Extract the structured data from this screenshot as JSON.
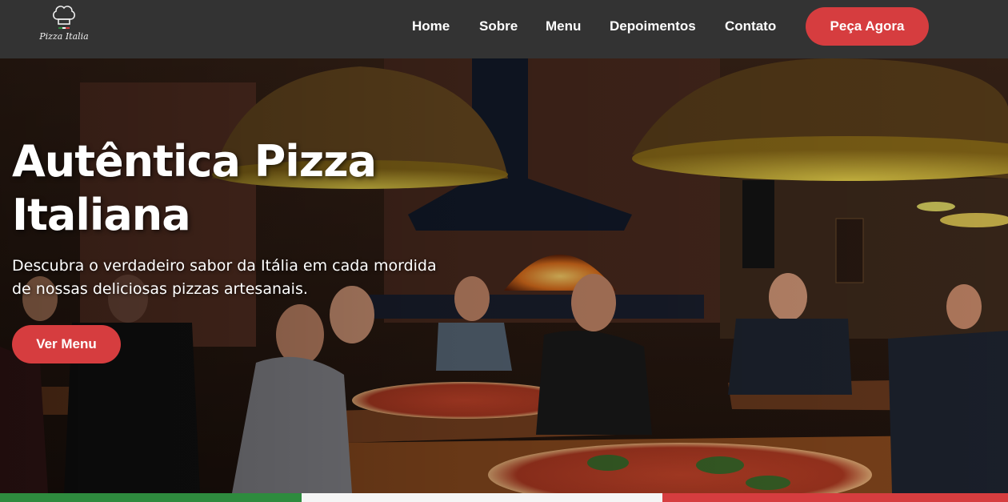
{
  "brand": {
    "name": "Pizza Italia",
    "logo_icon": "chef-hat-icon"
  },
  "nav": {
    "links": [
      "Home",
      "Sobre",
      "Menu",
      "Depoimentos",
      "Contato"
    ],
    "cta_label": "Peça Agora"
  },
  "hero": {
    "title": "Autêntica Pizza Italiana",
    "subtitle": "Descubra o verdadeiro sabor da Itália em cada mordida de nossas deliciosas pizzas artesanais.",
    "button_label": "Ver Menu"
  },
  "colors": {
    "navbar": "#333333",
    "accent": "#d63d3f",
    "flag_green": "#2e8b3e",
    "flag_white": "#f5f5f5",
    "flag_red": "#d63d3f"
  }
}
